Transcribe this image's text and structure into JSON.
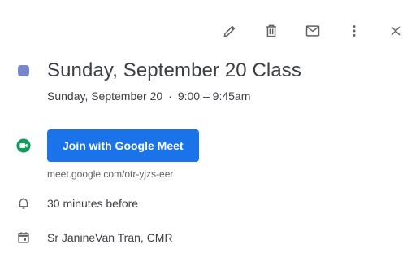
{
  "toolbar": {
    "edit": "edit-icon",
    "delete": "trash-icon",
    "email": "mail-icon",
    "more": "more-vert-icon",
    "close": "close-icon"
  },
  "event": {
    "color": "#7986cb",
    "title": "Sunday, September 20 Class",
    "date": "Sunday, September 20",
    "separator": "·",
    "time": "9:00 – 9:45am"
  },
  "meet": {
    "button_label": "Join with Google Meet",
    "link": "meet.google.com/otr-yjzs-eer",
    "accent": "#1a73e8"
  },
  "reminder": {
    "text": "30 minutes before"
  },
  "calendar": {
    "name": "Sr JanineVan Tran, CMR"
  }
}
